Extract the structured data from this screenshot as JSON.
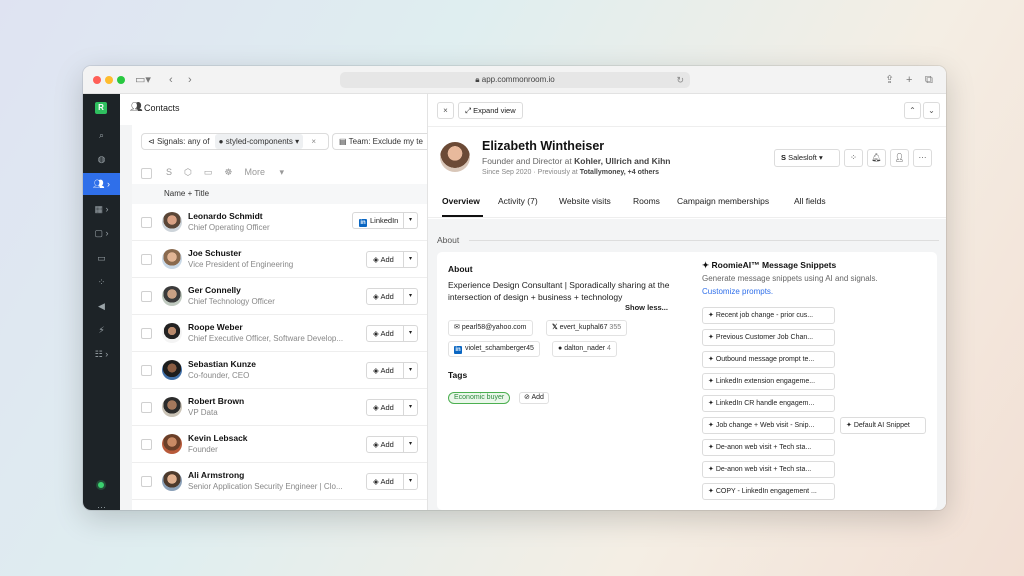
{
  "browser": {
    "url": "app.commonroom.io"
  },
  "sidebar": {
    "logo": "R"
  },
  "left": {
    "title": "Contacts",
    "filters": {
      "signals_label": "Signals: any of",
      "signals_value": "styled-components",
      "team_label": "Team:",
      "team_value": "Exclude my te"
    },
    "toolbar_more": "More",
    "column_header": "Name + Title",
    "rows": [
      {
        "name": "Leonardo Schmidt",
        "title": "Chief Operating Officer",
        "action": "LinkedIn"
      },
      {
        "name": "Joe Schuster",
        "title": "Vice President of Engineering",
        "action": "Add"
      },
      {
        "name": "Ger Connelly",
        "title": "Chief Technology Officer",
        "action": "Add"
      },
      {
        "name": "Roope Weber",
        "title": "Chief Executive Officer, Software Develop...",
        "action": "Add"
      },
      {
        "name": "Sebastian Kunze",
        "title": "Co-founder, CEO",
        "action": "Add"
      },
      {
        "name": "Robert Brown",
        "title": "VP Data",
        "action": "Add"
      },
      {
        "name": "Kevin Lebsack",
        "title": "Founder",
        "action": "Add"
      },
      {
        "name": "Ali Armstrong",
        "title": "Senior Application Security Engineer | Clo...",
        "action": "Add"
      }
    ]
  },
  "panel": {
    "expand_label": "Expand view",
    "name": "Elizabeth Wintheiser",
    "role_prefix": "Founder and Director at",
    "company": "Kohler, Ullrich and Kihn",
    "since_prefix": "Since Sep 2020 · Previously at",
    "previously": "Totallymoney, +4 others",
    "crm_button": "Salesloft",
    "tabs": [
      "Overview",
      "Activity (7)",
      "Website visits",
      "Rooms",
      "Campaign memberships",
      "All fields"
    ],
    "section_label": "About",
    "about": {
      "heading": "About",
      "description": "Experience Design Consultant | Sporadically sharing at the intersection of design + business + technology",
      "show_less": "Show less...",
      "email": "pearl58@yahoo.com",
      "twitter": "evert_kuphal67",
      "twitter_count": "355",
      "linkedin": "violet_schamberger45",
      "github": "dalton_nader",
      "github_count": "4",
      "tags_heading": "Tags",
      "tag": "Economic buyer",
      "add_tag": "Add"
    },
    "ai": {
      "heading": "RoomieAI™ Message Snippets",
      "subtitle": "Generate message snippets using AI and signals.",
      "link": "Customize prompts.",
      "snippets": [
        "Recent job change - prior cus...",
        "Previous Customer Job Chan...",
        "Outbound message prompt te...",
        "LinkedIn extension engageme...",
        "LinkedIn CR handle engagem...",
        "Job change + Web visit - Snip...",
        "Default AI Snippet",
        "De-anon web visit + Tech sta...",
        "De-anon web visit + Tech sta...",
        "COPY - LinkedIn engagement ..."
      ]
    }
  },
  "colors": {
    "accent": "#2f6fea",
    "rail": "#1d2327",
    "tag_green": "#2e8b3e"
  }
}
